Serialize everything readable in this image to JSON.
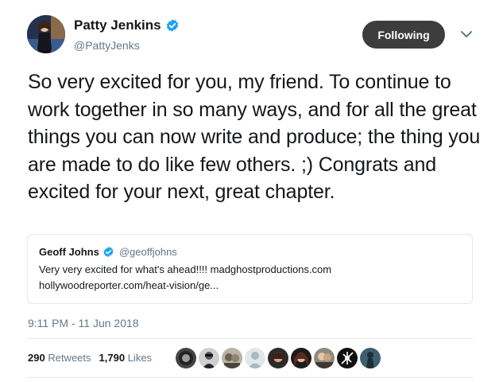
{
  "author": {
    "name": "Patty Jenkins",
    "handle": "@PattyJenks",
    "verified_icon": "verified-badge-icon",
    "avatar_icon": "user-avatar-icon"
  },
  "follow_button": {
    "label": "Following"
  },
  "caret_icon": "chevron-down-icon",
  "tweet": {
    "text": "So very excited for you, my friend. To continue to work together in so many ways, and for all the great things you can now write and produce; the thing you are made to do like few others. ;) Congrats and excited for your next, great chapter."
  },
  "quote": {
    "name": "Geoff Johns",
    "handle": "@geoffjohns",
    "line1": "Very very excited for what's ahead!!!! madghostproductions.com",
    "line2": "hollywoodreporter.com/heat-vision/ge..."
  },
  "timestamp": "9:11 PM - 11 Jun 2018",
  "stats": {
    "retweets_count": "290",
    "retweets_label": "Retweets",
    "likes_count": "1,790",
    "likes_label": "Likes"
  },
  "colors": {
    "verified_blue": "#1da1f2",
    "follow_button_bg": "#3d3d3d",
    "secondary_text": "#657786",
    "border": "#e1e8ed"
  }
}
